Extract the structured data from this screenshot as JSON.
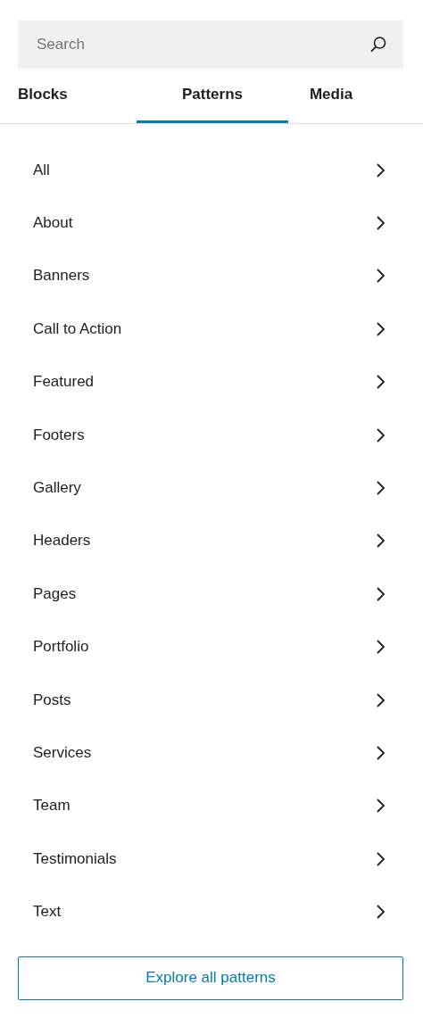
{
  "search": {
    "placeholder": "Search"
  },
  "tabs": [
    {
      "label": "Blocks",
      "selected": false
    },
    {
      "label": "Patterns",
      "selected": true
    },
    {
      "label": "Media",
      "selected": false
    }
  ],
  "categories": [
    {
      "label": "All"
    },
    {
      "label": "About"
    },
    {
      "label": "Banners"
    },
    {
      "label": "Call to Action"
    },
    {
      "label": "Featured"
    },
    {
      "label": "Footers"
    },
    {
      "label": "Gallery"
    },
    {
      "label": "Headers"
    },
    {
      "label": "Pages"
    },
    {
      "label": "Portfolio"
    },
    {
      "label": "Posts"
    },
    {
      "label": "Services"
    },
    {
      "label": "Team"
    },
    {
      "label": "Testimonials"
    },
    {
      "label": "Text"
    }
  ],
  "explore_button": {
    "label": "Explore all patterns"
  }
}
